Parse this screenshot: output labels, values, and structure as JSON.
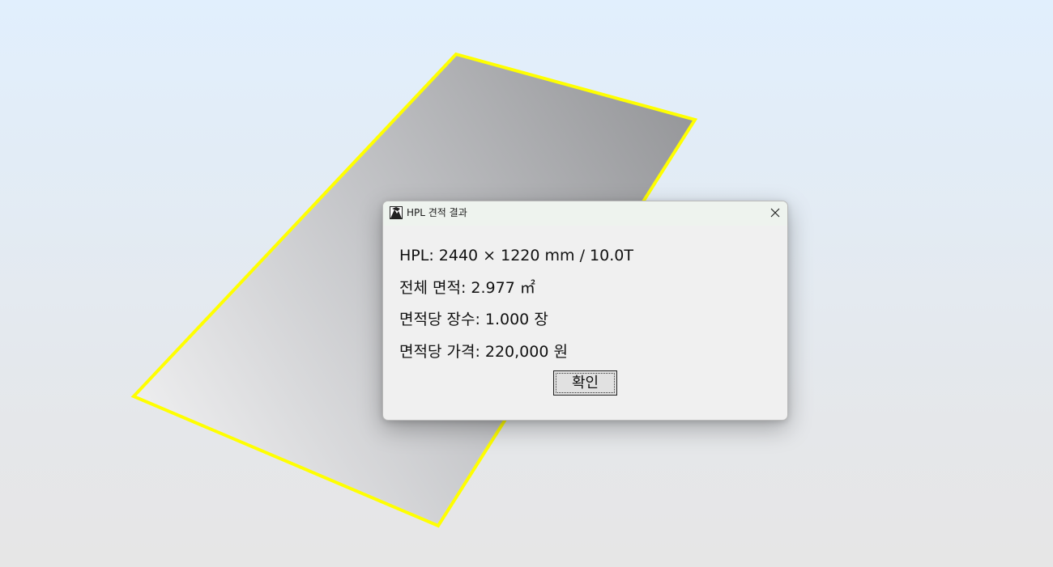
{
  "viewport": {
    "background_top": "#e1effd",
    "background_bottom": "#e6e6e6",
    "panel_outline_color": "#ffff00",
    "panel_fill_light": "#f0f0f0",
    "panel_fill_dark": "#96979a"
  },
  "dialog": {
    "title": "HPL 견적 결과",
    "app_icon": "app-logo-icon",
    "close_icon": "close-icon",
    "lines": {
      "hpl": "HPL: 2440 × 1220 mm / 10.0T",
      "area": "전체 면적: 2.977 ㎡",
      "sheets": "면적당 장수: 1.000 장",
      "price": "면적당 가격: 220,000 원"
    },
    "ok_label": "확인"
  }
}
